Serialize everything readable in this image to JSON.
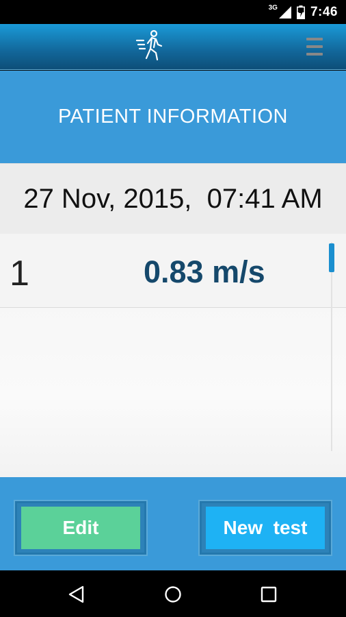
{
  "status_bar": {
    "network_label": "3G",
    "time": "7:46",
    "icons": [
      "signal-icon",
      "battery-charging-icon"
    ]
  },
  "app_bar": {
    "logo_icon": "walking-person-icon",
    "menu_icon": "hamburger-menu-icon"
  },
  "page": {
    "title": "PATIENT INFORMATION",
    "datetime": "27 Nov, 2015,  07:41 AM"
  },
  "results": [
    {
      "index": "1",
      "speed": "0.83 m/s"
    }
  ],
  "actions": {
    "edit_label": "Edit",
    "new_test_label": "New  test"
  },
  "colors": {
    "accent": "#3a9ad9",
    "value_text": "#15486b",
    "edit_button": "#5bd199",
    "new_test_button": "#1eb2f4"
  },
  "nav_bar": {
    "icons": [
      "back-icon",
      "home-icon",
      "recent-apps-icon"
    ]
  }
}
